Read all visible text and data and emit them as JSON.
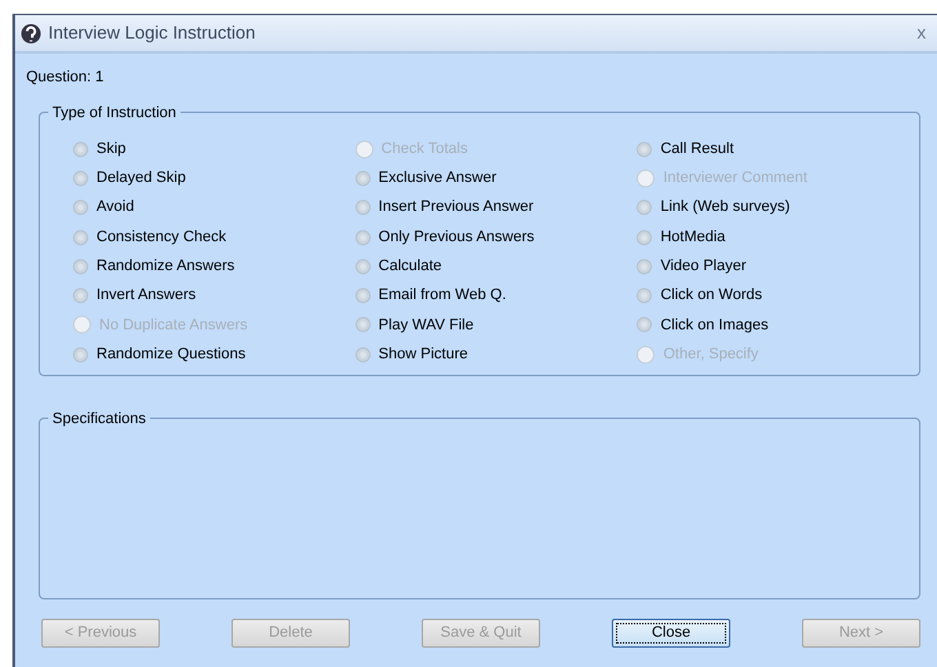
{
  "window": {
    "title": "Interview Logic Instruction",
    "close": "x"
  },
  "question_label": "Question: 1",
  "instruction_group": {
    "title": "Type of Instruction",
    "columns": [
      [
        {
          "label": "Skip",
          "disabled": false,
          "selected": false
        },
        {
          "label": "Delayed Skip",
          "disabled": false,
          "selected": false
        },
        {
          "label": "Avoid",
          "disabled": false,
          "selected": false
        },
        {
          "label": "Consistency Check",
          "disabled": false,
          "selected": false
        },
        {
          "label": "Randomize Answers",
          "disabled": false,
          "selected": false
        },
        {
          "label": "Invert Answers",
          "disabled": false,
          "selected": false
        },
        {
          "label": "No Duplicate Answers",
          "disabled": true,
          "selected": false
        },
        {
          "label": "Randomize Questions",
          "disabled": false,
          "selected": false
        }
      ],
      [
        {
          "label": "Check Totals",
          "disabled": true,
          "selected": false
        },
        {
          "label": "Exclusive Answer",
          "disabled": false,
          "selected": false
        },
        {
          "label": "Insert Previous Answer",
          "disabled": false,
          "selected": false
        },
        {
          "label": "Only Previous Answers",
          "disabled": false,
          "selected": false
        },
        {
          "label": "Calculate",
          "disabled": false,
          "selected": false
        },
        {
          "label": "Email from Web Q.",
          "disabled": false,
          "selected": false
        },
        {
          "label": "Play WAV File",
          "disabled": false,
          "selected": false
        },
        {
          "label": "Show Picture",
          "disabled": false,
          "selected": false
        }
      ],
      [
        {
          "label": "Call Result",
          "disabled": false,
          "selected": false
        },
        {
          "label": "Interviewer Comment",
          "disabled": true,
          "selected": false
        },
        {
          "label": "Link (Web surveys)",
          "disabled": false,
          "selected": false
        },
        {
          "label": "HotMedia",
          "disabled": false,
          "selected": false
        },
        {
          "label": "Video Player",
          "disabled": false,
          "selected": false
        },
        {
          "label": "Click on Words",
          "disabled": false,
          "selected": false
        },
        {
          "label": "Click on Images",
          "disabled": false,
          "selected": false
        },
        {
          "label": "Other, Specify",
          "disabled": true,
          "selected": false
        }
      ]
    ]
  },
  "specifications": {
    "title": "Specifications"
  },
  "buttons": [
    {
      "label": "< Previous",
      "disabled": true,
      "focused": false
    },
    {
      "label": "Delete",
      "disabled": true,
      "focused": false
    },
    {
      "label": "Save & Quit",
      "disabled": true,
      "focused": false
    },
    {
      "label": "Close",
      "disabled": false,
      "focused": true
    },
    {
      "label": "Next >",
      "disabled": true,
      "focused": false
    }
  ]
}
